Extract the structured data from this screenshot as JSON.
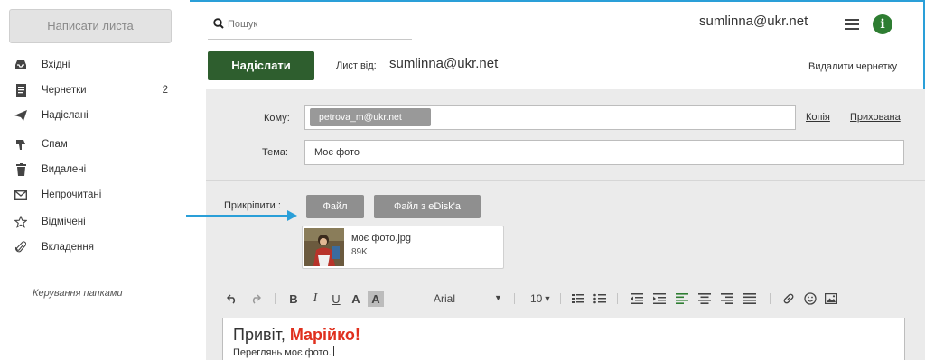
{
  "sidebar": {
    "compose_label": "Написати листа",
    "folders": [
      {
        "label": "Вхідні",
        "icon": "inbox-icon"
      },
      {
        "label": "Чернетки",
        "icon": "drafts-icon",
        "count": "2"
      },
      {
        "label": "Надіслані",
        "icon": "sent-icon"
      },
      {
        "label": "Спам",
        "icon": "spam-icon"
      },
      {
        "label": "Видалені",
        "icon": "trash-icon"
      },
      {
        "label": "Непрочитані",
        "icon": "unread-icon"
      },
      {
        "label": "Відмічені",
        "icon": "star-icon"
      },
      {
        "label": "Вкладення",
        "icon": "paperclip-icon"
      }
    ],
    "manage_folders_label": "Керування папками"
  },
  "header": {
    "search_placeholder": "Пошук",
    "user_email": "sumlinna@ukr.net"
  },
  "compose": {
    "send_label": "Надіслати",
    "from_label": "Лист від:",
    "from_value": "sumlinna@ukr.net",
    "delete_draft_label": "Видалити чернетку",
    "to_label": "Кому:",
    "to_recipient": "petrova_m@ukr.net",
    "cc_label": "Копія",
    "bcc_label": "Прихована",
    "subject_label": "Тема:",
    "subject_value": "Моє фото",
    "attach_label": "Прикріпити :",
    "file_button_label": "Файл",
    "edisk_button_label": "Файл з eDisk'a",
    "attachment": {
      "name": "моє фото.jpg",
      "size": "89K"
    }
  },
  "toolbar": {
    "font_name": "Arial",
    "font_size": "10",
    "bold": "B",
    "italic": "I",
    "underline": "U",
    "text_color": "A",
    "bg_color": "A"
  },
  "editor": {
    "greeting_prefix": "Привіт, ",
    "greeting_name": "Марійко!",
    "body_text": "Переглянь моє фото."
  },
  "colors": {
    "accent_blue": "#2a9fd8",
    "send_green": "#2e5e2e",
    "info_green": "#2e7d32",
    "highlight_red": "#e0301e",
    "panel_grey": "#ebebeb"
  }
}
